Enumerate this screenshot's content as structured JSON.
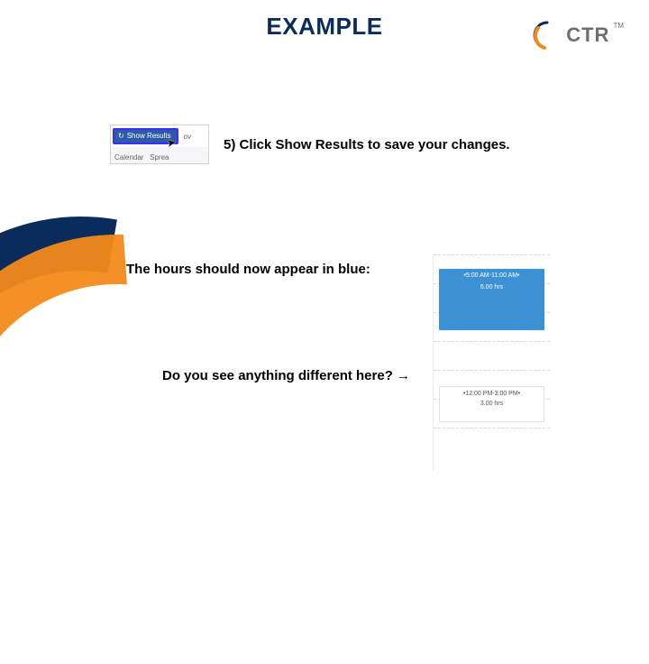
{
  "header": {
    "title": "EXAMPLE",
    "logo_text": "CTR",
    "logo_tm": "TM"
  },
  "step5": {
    "button_label": "Show Results",
    "right_label": "ov",
    "bottom_left": "Calendar",
    "bottom_right": "Sprea",
    "instruction": "5) Click Show Results to save your changes."
  },
  "mid_line": "The hours should now appear in blue:",
  "calendar": {
    "block1_time": "•5:00 AM-11:00 AM•",
    "block1_hours": "6.00 hrs",
    "block2_time": "•12:00 PM-3:00 PM•",
    "block2_hours": "3.00 hrs"
  },
  "question": "Do you see anything different here? →"
}
